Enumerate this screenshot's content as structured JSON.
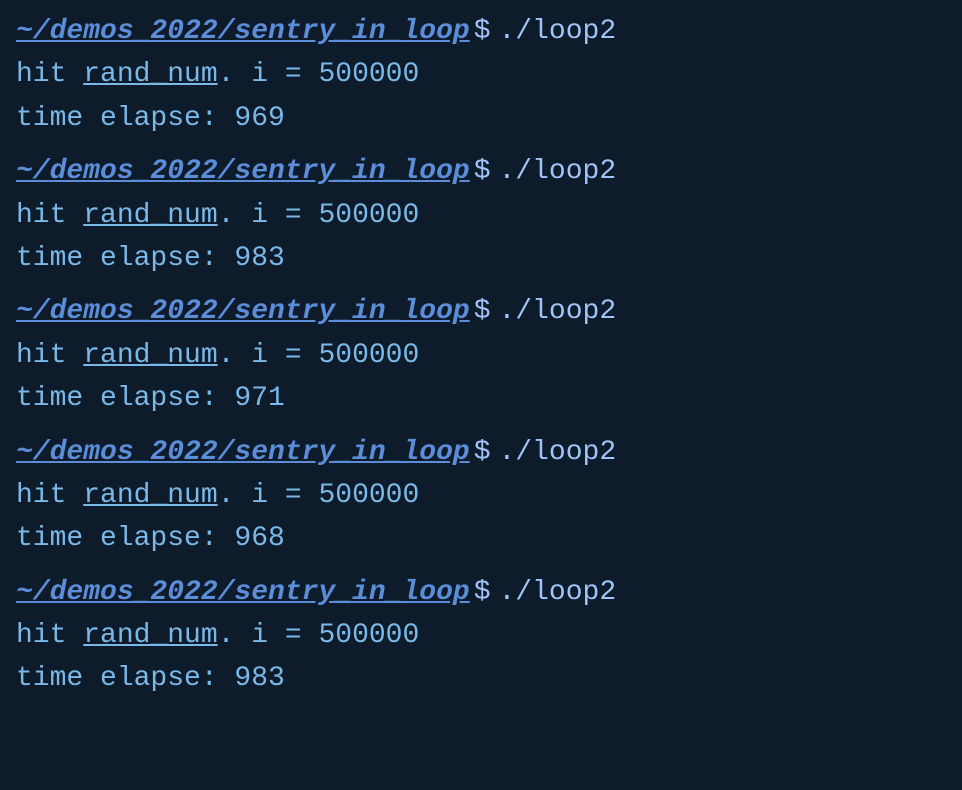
{
  "terminal": {
    "background": "#0d1b2a",
    "blocks": [
      {
        "prompt_path": "~/demos_2022/sentry_in_loop",
        "prompt_symbol": "$",
        "command": "./loop2",
        "line1": "hit rand_num. i = 500000",
        "line2": "time elapse: 969"
      },
      {
        "prompt_path": "~/demos_2022/sentry_in_loop",
        "prompt_symbol": "$",
        "command": "./loop2",
        "line1": "hit rand_num. i = 500000",
        "line2": "time elapse: 983"
      },
      {
        "prompt_path": "~/demos_2022/sentry_in_loop",
        "prompt_symbol": "$",
        "command": "./loop2",
        "line1": "hit rand_num. i = 500000",
        "line2": "time elapse: 971"
      },
      {
        "prompt_path": "~/demos_2022/sentry_in_loop",
        "prompt_symbol": "$",
        "command": "./loop2",
        "line1": "hit rand_num. i = 500000",
        "line2": "time elapse: 968"
      },
      {
        "prompt_path": "~/demos_2022/sentry_in_loop",
        "prompt_symbol": "$",
        "command": "./loop2",
        "line1": "hit rand_num. i = 500000",
        "line2": "time elapse: 983"
      }
    ]
  }
}
